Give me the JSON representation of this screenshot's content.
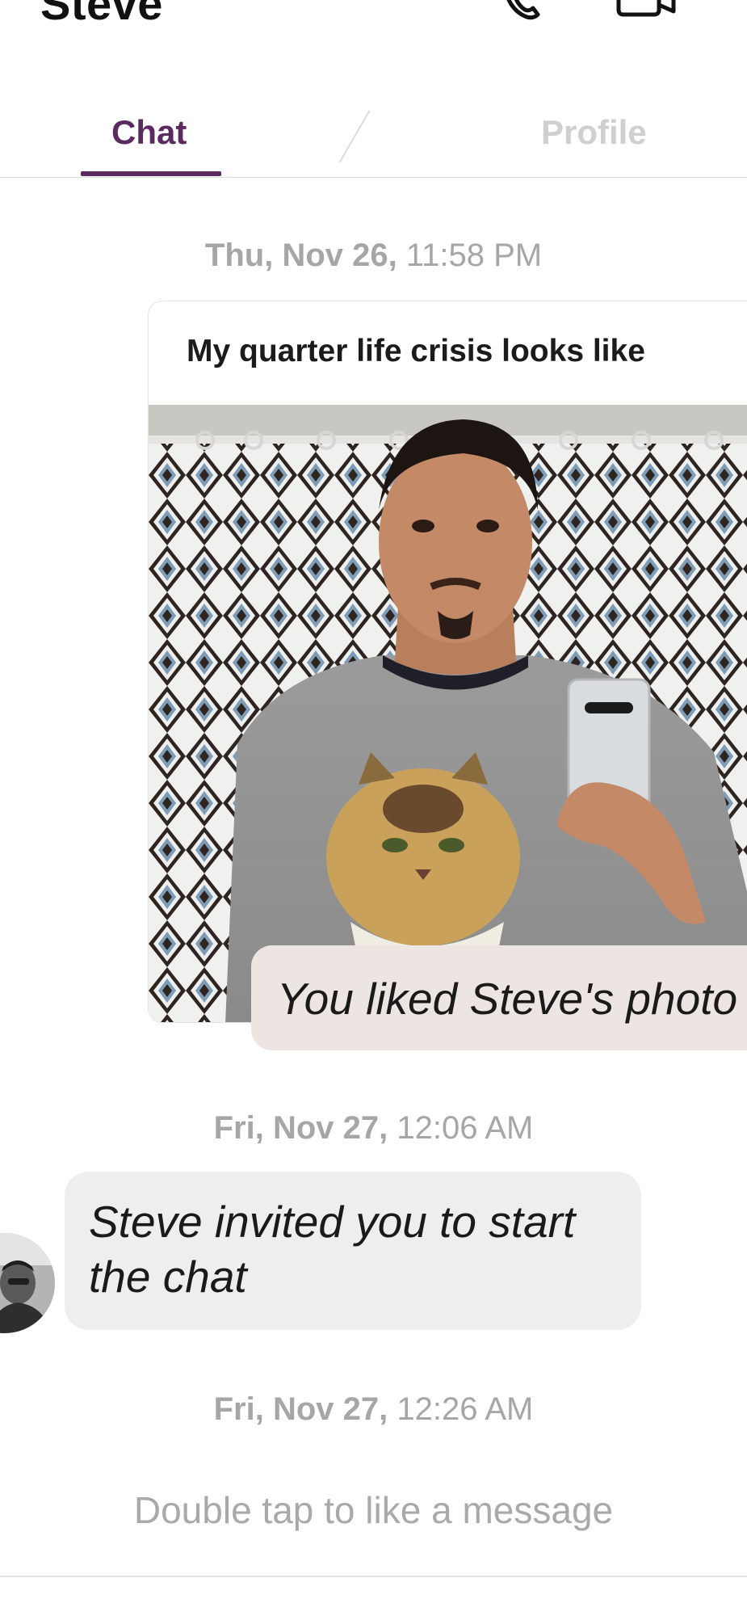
{
  "header": {
    "contact_name": "Steve",
    "call_icon": "phone-icon",
    "video_icon": "video-camera-icon"
  },
  "tabs": [
    {
      "label": "Chat",
      "active": true
    },
    {
      "label": "Profile",
      "active": false
    }
  ],
  "accent_color": "#5b2a5e",
  "messages": {
    "first_timestamp": {
      "date": "Thu, Nov 26,",
      "time": "11:58 PM"
    },
    "photo_card": {
      "caption": "My quarter life crisis looks like",
      "like_label": "You liked Steve's photo"
    },
    "second_timestamp": {
      "date": "Fri, Nov 27,",
      "time": "12:06 AM"
    },
    "invite_text": "Steve invited you to start the chat",
    "third_timestamp": {
      "date": "Fri, Nov 27,",
      "time": "12:26 AM"
    }
  },
  "hint": "Double tap to like a message"
}
